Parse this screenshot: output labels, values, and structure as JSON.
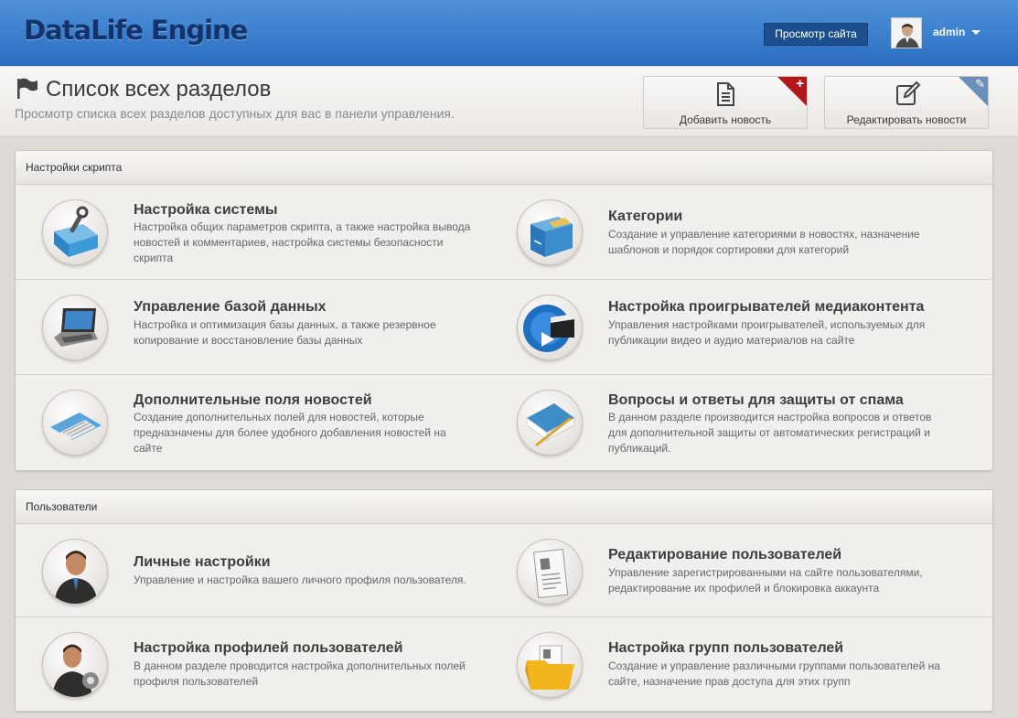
{
  "app": {
    "logo": "DataLife Engine"
  },
  "topbar": {
    "view_site_label": "Просмотр сайта",
    "user_name": "admin"
  },
  "header": {
    "title": "Список всех разделов",
    "subtitle": "Просмотр списка всех разделов доступных для вас в панели управления.",
    "add_news_label": "Добавить новость",
    "edit_news_label": "Редактировать новости",
    "add_corner_glyph": "+",
    "edit_corner_glyph": "✎"
  },
  "sections": [
    {
      "title": "Настройки скрипта",
      "items": [
        {
          "icon": "toolbox-icon",
          "title": "Настройка системы",
          "desc": "Настройка общих параметров скрипта, а также настройка вывода новостей и комментариев, настройка системы безопасности скрипта"
        },
        {
          "icon": "file-cabinet-icon",
          "title": "Категории",
          "desc": "Создание и управление категориями в новостях, назначение шаблонов и порядок сортировки для категорий"
        },
        {
          "icon": "laptop-icon",
          "title": "Управление базой данных",
          "desc": "Настройка и оптимизация базы данных, а также резервное копирование и восстановление базы данных"
        },
        {
          "icon": "media-player-icon",
          "title": "Настройка проигрывателей медиаконтента",
          "desc": "Управления настройками проигрывателей, используемых для публикации видео и аудио материалов на сайте"
        },
        {
          "icon": "keyboard-icon",
          "title": "Дополнительные поля новостей",
          "desc": "Создание дополнительных полей для новостей, которые предназначены для более удобного добавления новостей на сайте"
        },
        {
          "icon": "notebook-pen-icon",
          "title": "Вопросы и ответы для защиты от спама",
          "desc": "В данном разделе производится настройка вопросов и ответов для дополнительной защиты от автоматических регистраций и публикаций."
        }
      ]
    },
    {
      "title": "Пользователи",
      "items": [
        {
          "icon": "user-icon",
          "title": "Личные настройки",
          "desc": "Управление и настройка вашего личного профиля пользователя."
        },
        {
          "icon": "user-document-icon",
          "title": "Редактирование пользователей",
          "desc": "Управление зарегистрированными на сайте пользователями, редактирование их профилей и блокировка аккаунта"
        },
        {
          "icon": "user-gear-icon",
          "title": "Настройка профилей пользователей",
          "desc": "В данном разделе проводится настройка дополнительных полей профиля пользователей"
        },
        {
          "icon": "user-folder-icon",
          "title": "Настройка групп пользователей",
          "desc": "Создание и управление различными группами пользователей на сайте, назначение прав доступа для этих групп"
        }
      ]
    }
  ]
}
